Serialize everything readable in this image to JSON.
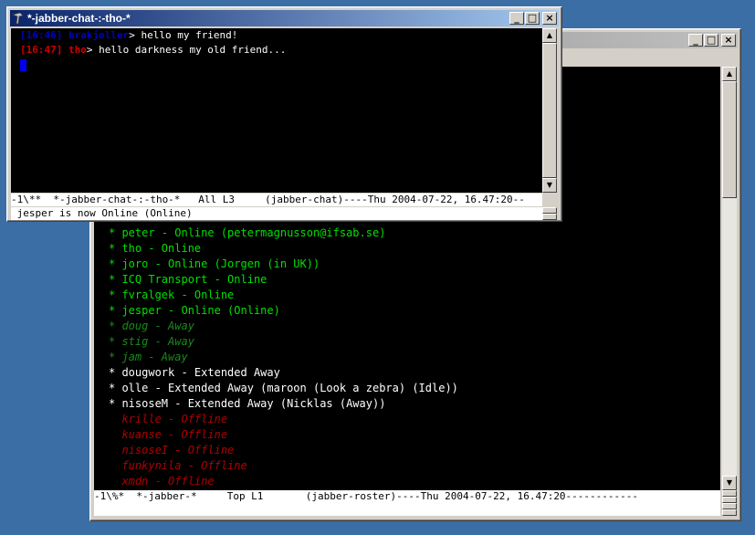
{
  "chat_window": {
    "title": "*-jabber-chat-:-tho-*",
    "messages": [
      {
        "time": "[16:46]",
        "user": "brakjoller",
        "text": "> hello my friend!"
      },
      {
        "time": "[16:47]",
        "user": "tho",
        "text": "> hello darkness my old friend..."
      }
    ],
    "modeline": "-1\\**  *-jabber-chat-:-tho-*   All L3     (jabber-chat)----Thu 2004-07-22, 16.47:20--",
    "minibuffer": " jesper is now Online (Online)"
  },
  "roster_window": {
    "title": "",
    "contacts": [
      {
        "text": "* peter - Online (petermagnusson@ifsab.se)",
        "status": "online"
      },
      {
        "text": "* tho - Online",
        "status": "online"
      },
      {
        "text": "* joro - Online (Jorgen (in UK))",
        "status": "online"
      },
      {
        "text": "* ICQ Transport - Online",
        "status": "online"
      },
      {
        "text": "* fvralgek - Online",
        "status": "online"
      },
      {
        "text": "* jesper - Online (Online)",
        "status": "online"
      },
      {
        "text": "* doug - Away",
        "status": "away"
      },
      {
        "text": "* stig - Away",
        "status": "away"
      },
      {
        "text": "* jam - Away",
        "status": "away"
      },
      {
        "text": "* dougwork - Extended Away",
        "status": "xa"
      },
      {
        "text": "* olle - Extended Away (maroon (Look a zebra) (Idle))",
        "status": "xa"
      },
      {
        "text": "* nisoseM - Extended Away (Nicklas (Away))",
        "status": "xa"
      },
      {
        "text": "  krille - Offline",
        "status": "offline"
      },
      {
        "text": "  kuanse - Offline",
        "status": "offline"
      },
      {
        "text": "  nisoseI - Offline",
        "status": "offline"
      },
      {
        "text": "  funkynila - Offline",
        "status": "offline"
      },
      {
        "text": "  xmdn - Offline",
        "status": "offline"
      }
    ],
    "modeline": "-1\\%*  *-jabber-*     Top L1       (jabber-roster)----Thu 2004-07-22, 16.47:20------------"
  },
  "colors": {
    "desktop": "#3a6ea5",
    "timestamp_self": "#0000cc",
    "user_self": "#0000cc",
    "timestamp_other": "#cc0000",
    "user_other": "#cc0000",
    "online": "#00e000",
    "away": "#1a8a1a",
    "xa": "#ffffff",
    "offline": "#b00000"
  },
  "window_buttons": {
    "minimize": "_",
    "maximize": "□",
    "close": "×"
  }
}
